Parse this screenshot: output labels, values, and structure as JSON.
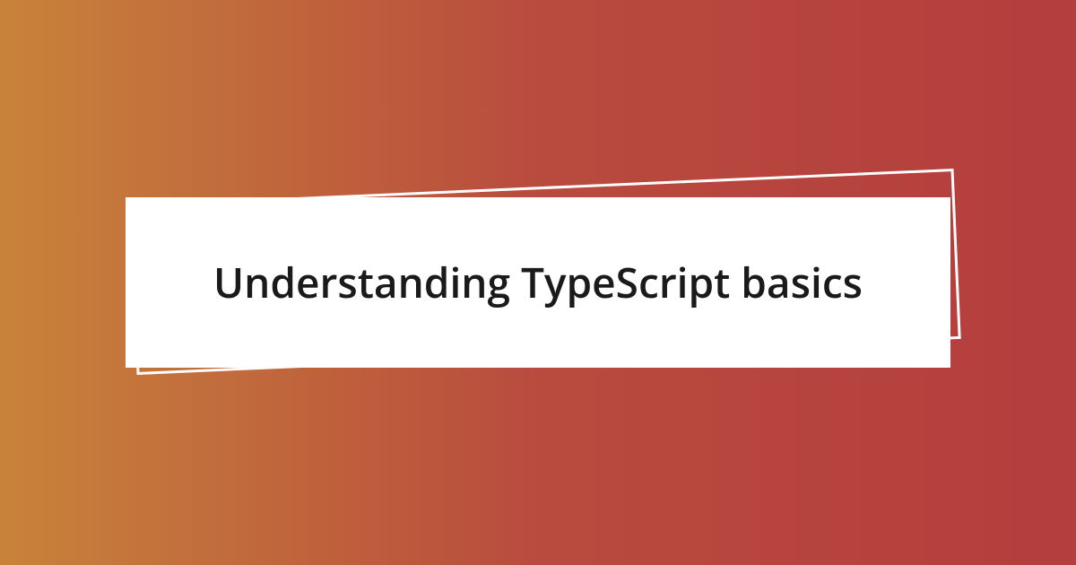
{
  "card": {
    "title": "Understanding TypeScript basics"
  },
  "colors": {
    "gradient_start": "#c8833a",
    "gradient_end": "#b43d3d",
    "card_bg": "#ffffff",
    "frame_border": "#ffffff",
    "text": "#1a1a1a"
  }
}
